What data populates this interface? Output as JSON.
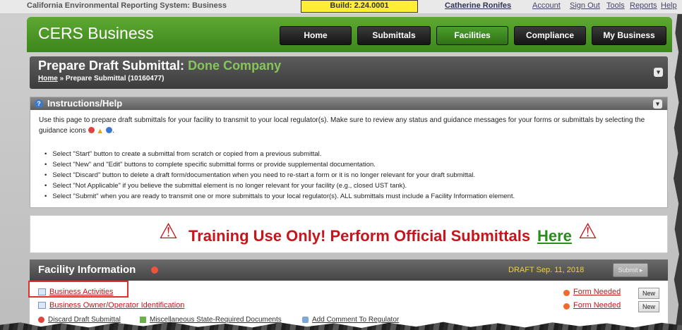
{
  "system_bar": {
    "title": "California Environmental Reporting System: Business",
    "build": "Build: 2.24.0001",
    "user": "Catherine Ronifes",
    "links": [
      "Account",
      "Sign Out",
      "Tools",
      "Reports",
      "Help"
    ]
  },
  "header": {
    "logo": "CERS Business",
    "nav": [
      "Home",
      "Submittals",
      "Facilities",
      "Compliance",
      "My Business"
    ],
    "active": "Facilities"
  },
  "title_panel": {
    "title_prefix": "Prepare Draft Submittal:",
    "company": "Done Company",
    "breadcrumb_home": "Home",
    "breadcrumb_sep": "»",
    "breadcrumb_current": "Prepare Submittal (10160477)"
  },
  "instructions": {
    "title": "Instructions/Help",
    "intro": "Use this page to prepare draft submittals for your facility to transmit to your local regulator(s). Make sure to review any status and guidance messages for your forms or submittals by selecting the guidance icons",
    "bullets": [
      "Select \"Start\" button to create a submittal from scratch or copied from a previous submittal.",
      "Select \"New\" and \"Edit\" buttons to complete specific submittal forms or provide supplemental documentation.",
      "Select \"Discard\" button to delete a draft form/documentation when you need to re-start a form or it is no longer relevant for your draft submittal.",
      "Select \"Not Applicable\" if you believe the submittal element is no longer relevant for your facility (e.g., closed UST tank).",
      "Select \"Submit\" when you are ready to transmit one or more submittals to your local regulator(s). ALL submittals must include a Facility Information element."
    ]
  },
  "training": {
    "message": "Training Use Only! Perform Official Submittals",
    "link": "Here"
  },
  "facility": {
    "title": "Facility Information",
    "draft": "DRAFT Sep. 11, 2018",
    "submit": "Submit",
    "rows": [
      {
        "label": "Business Activities",
        "status": "Form Needed",
        "action": "New"
      },
      {
        "label": "Business Owner/Operator Identification",
        "status": "Form Needed",
        "action": "New"
      }
    ],
    "actions": [
      "Discard Draft Submittal",
      "Miscellaneous State-Required Documents",
      "Add Comment To Regulator"
    ]
  },
  "colors": {
    "header_green": "#4a9a26",
    "title_company": "#86c55a",
    "alert_red": "#c4161c",
    "here_green": "#2a8c1e",
    "draft_yellow": "#f2d33c",
    "highlight": "#e0312b"
  }
}
